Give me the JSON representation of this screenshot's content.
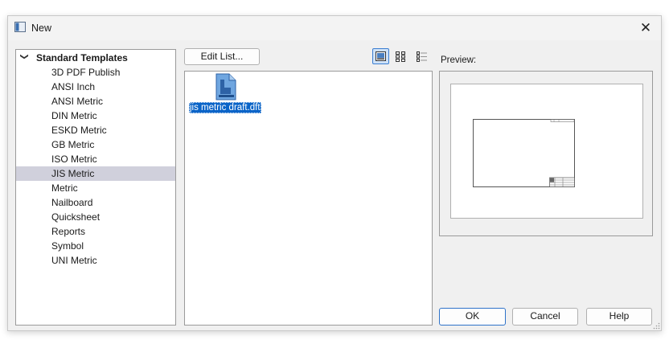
{
  "window": {
    "title": "New",
    "icon": "template-app-icon",
    "close_glyph": "✕"
  },
  "tree": {
    "root": {
      "label": "Standard Templates",
      "expanded": true,
      "chevron_glyph": "❯"
    },
    "items": [
      {
        "label": "3D PDF Publish",
        "selected": false
      },
      {
        "label": "ANSI Inch",
        "selected": false
      },
      {
        "label": "ANSI Metric",
        "selected": false
      },
      {
        "label": "DIN Metric",
        "selected": false
      },
      {
        "label": "ESKD Metric",
        "selected": false
      },
      {
        "label": "GB Metric",
        "selected": false
      },
      {
        "label": "ISO Metric",
        "selected": false
      },
      {
        "label": "JIS Metric",
        "selected": true
      },
      {
        "label": "Metric",
        "selected": false
      },
      {
        "label": "Nailboard",
        "selected": false
      },
      {
        "label": "Quicksheet",
        "selected": false
      },
      {
        "label": "Reports",
        "selected": false
      },
      {
        "label": "Symbol",
        "selected": false
      },
      {
        "label": "UNI Metric",
        "selected": false
      }
    ]
  },
  "toolbar": {
    "edit_list_label": "Edit List...",
    "view_modes": [
      {
        "name": "large-icons-view",
        "active": true
      },
      {
        "name": "list-view",
        "active": false
      },
      {
        "name": "details-view",
        "active": false
      }
    ]
  },
  "files": [
    {
      "label": "jis metric draft.dft",
      "icon": "draft-document-icon",
      "selected": true
    }
  ],
  "preview": {
    "label": "Preview:"
  },
  "buttons": {
    "ok": "OK",
    "cancel": "Cancel",
    "help": "Help"
  },
  "colors": {
    "dialog_bg": "#f0f0f0",
    "selection_bg": "#0a64c8",
    "tree_selected_bg": "#d0d0dc",
    "accent_border": "#2f73c9"
  }
}
